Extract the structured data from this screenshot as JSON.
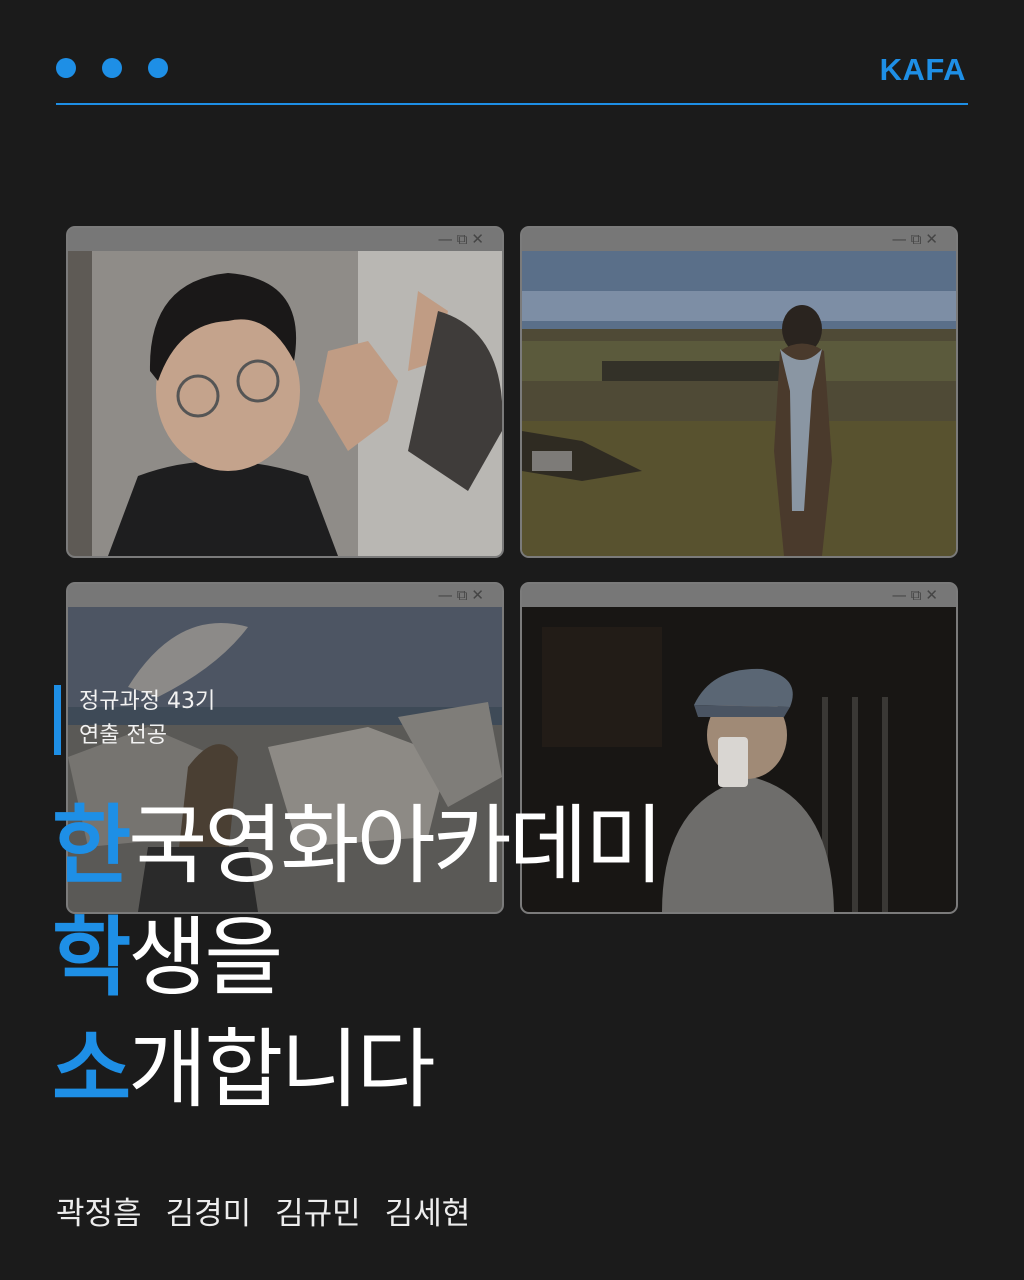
{
  "header": {
    "logo": "KAFA",
    "brand_color": "#1e8fe6"
  },
  "windows": [
    {
      "controls": "—⧉✕",
      "photo": "student-portrait-finger-frame"
    },
    {
      "controls": "—⧉✕",
      "photo": "student-on-field-with-camera"
    },
    {
      "controls": "—⧉✕",
      "photo": "student-with-boom-mic-at-shore"
    },
    {
      "controls": "—⧉✕",
      "photo": "student-drinking-at-night"
    }
  ],
  "tagline": {
    "line1": "정규과정 43기",
    "line2": "연출 전공"
  },
  "headline": [
    {
      "first": "한",
      "rest": "국영화아카데미"
    },
    {
      "first": "학",
      "rest": "생을"
    },
    {
      "first": "소",
      "rest": "개합니다"
    }
  ],
  "names": [
    "곽정흠",
    "김경미",
    "김규민",
    "김세현"
  ]
}
